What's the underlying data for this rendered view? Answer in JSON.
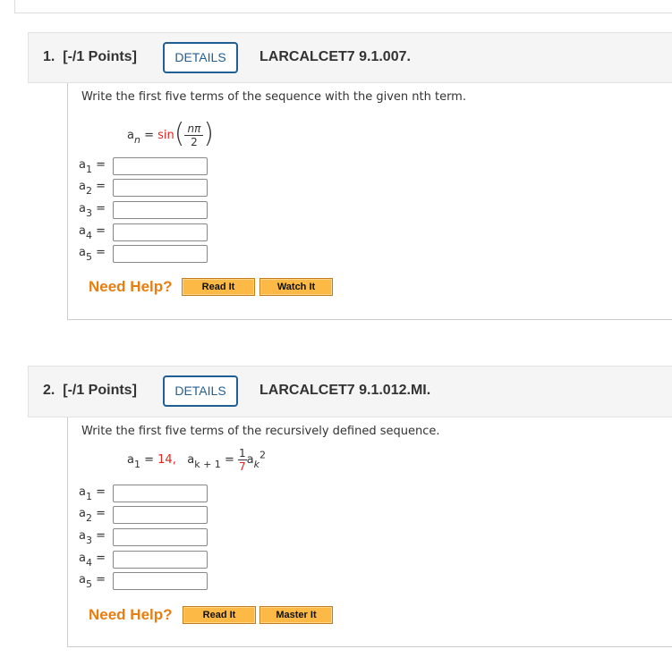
{
  "questions": [
    {
      "number": "1.",
      "points": "[-/1 Points]",
      "details": "DETAILS",
      "id": "LARCALCET7 9.1.007.",
      "prompt": "Write the first five terms of the sequence with the given nth term.",
      "formula": {
        "lhs": "a",
        "lhs_sub": "n",
        "eq": "=",
        "func": "sin",
        "num": "nπ",
        "den": "2"
      },
      "labels": [
        "1",
        "2",
        "3",
        "4",
        "5"
      ],
      "help": "Need Help?",
      "buttons": [
        "Read It",
        "Watch It"
      ]
    },
    {
      "number": "2.",
      "points": "[-/1 Points]",
      "details": "DETAILS",
      "id": "LARCALCET7 9.1.012.MI.",
      "prompt": "Write the first five terms of the recursively defined sequence.",
      "formula": {
        "a1": "a",
        "a1_sub": "1",
        "eq": "=",
        "a1_val": "14,",
        "ak1": "a",
        "ak1_sub": "k + 1",
        "num": "1",
        "den": "7",
        "ak": "a",
        "ak_sub": "k",
        "ak_exp": "2"
      },
      "labels": [
        "1",
        "2",
        "3",
        "4",
        "5"
      ],
      "help": "Need Help?",
      "buttons": [
        "Read It",
        "Master It"
      ]
    }
  ]
}
